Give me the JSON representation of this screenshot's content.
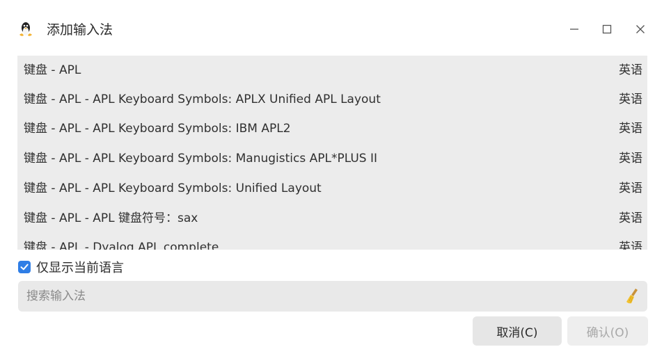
{
  "window": {
    "title": "添加输入法"
  },
  "list": {
    "rows": [
      {
        "name": "键盘 - APL",
        "lang": "英语"
      },
      {
        "name": "键盘 - APL - APL Keyboard Symbols: APLX Unified APL Layout",
        "lang": "英语"
      },
      {
        "name": "键盘 - APL - APL Keyboard Symbols: IBM APL2",
        "lang": "英语"
      },
      {
        "name": "键盘 - APL - APL Keyboard Symbols: Manugistics APL*PLUS II",
        "lang": "英语"
      },
      {
        "name": "键盘 - APL - APL Keyboard Symbols: Unified Layout",
        "lang": "英语"
      },
      {
        "name": "键盘 - APL - APL 键盘符号：sax",
        "lang": "英语"
      },
      {
        "name": "键盘 - APL - Dyalog APL complete",
        "lang": "英语"
      }
    ]
  },
  "filter": {
    "checkbox_label": "仅显示当前语言",
    "checked": true
  },
  "search": {
    "placeholder": "搜索输入法",
    "value": ""
  },
  "buttons": {
    "cancel": "取消(C)",
    "confirm": "确认(O)"
  },
  "colors": {
    "accent": "#2f7ee6",
    "list_bg": "#ececec"
  },
  "icons": {
    "app": "penguin-icon",
    "minimize": "minimize-icon",
    "maximize": "maximize-icon",
    "close": "close-icon",
    "clear": "broom-icon",
    "check": "check-icon"
  }
}
